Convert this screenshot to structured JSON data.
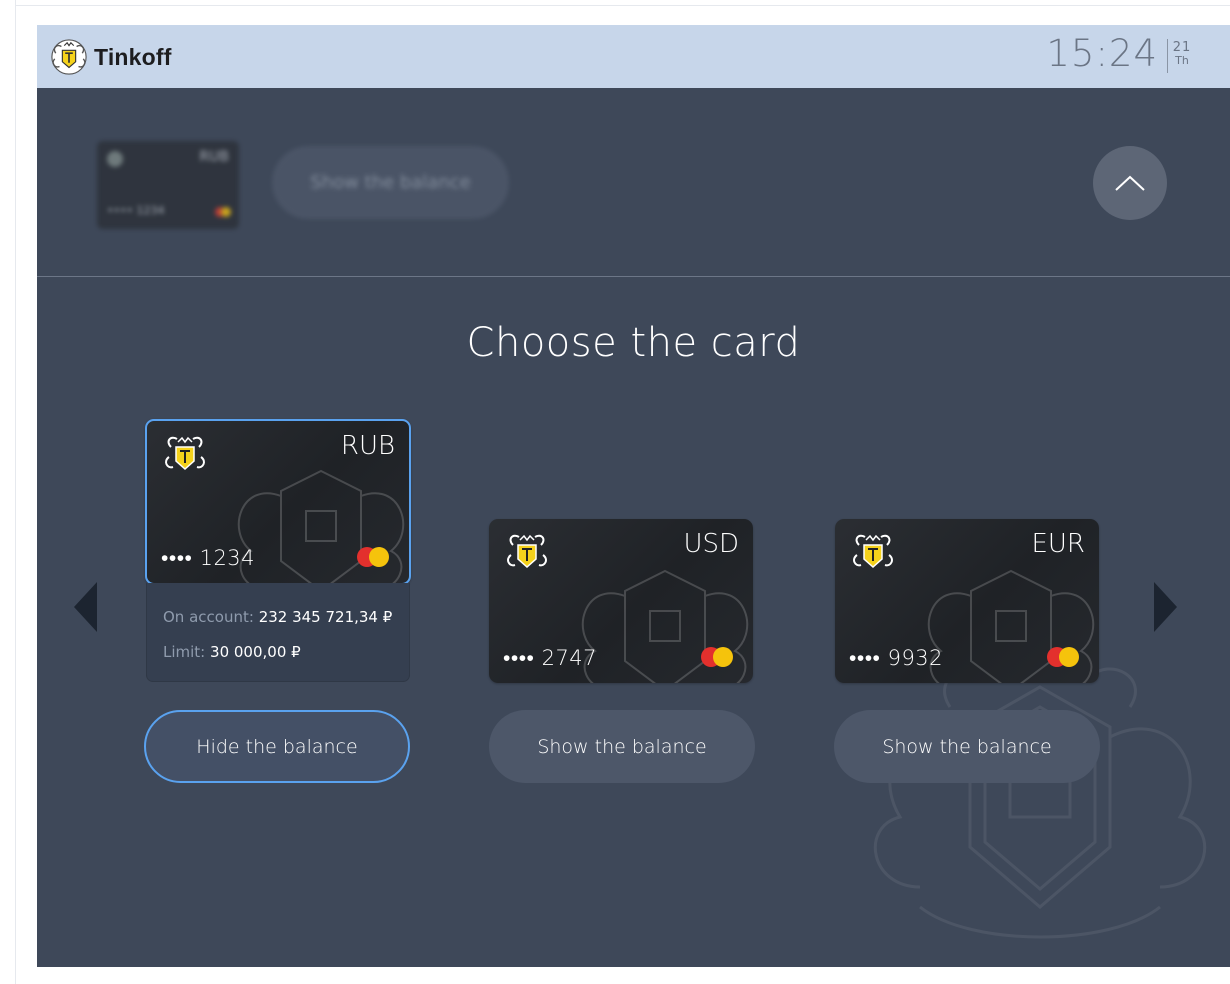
{
  "header": {
    "brand": "Tinkoff",
    "time": "15:24",
    "date_day": "21",
    "date_weekday": "Th"
  },
  "selected_strip": {
    "card_currency": "RUB",
    "card_number": "•••• 1234",
    "button_label": "Show the balance",
    "collapse_icon": "chevron-up-icon"
  },
  "title": "Choose the card",
  "cards": [
    {
      "currency": "RUB",
      "number": "•••• 1234",
      "selected": true,
      "balance": {
        "account_label": "On account:",
        "account_value": "232 345 721,34 ₽",
        "limit_label": "Limit:",
        "limit_value": "30 000,00 ₽"
      },
      "button_label": "Hide the balance"
    },
    {
      "currency": "USD",
      "number": "•••• 2747",
      "selected": false,
      "button_label": "Show the balance"
    },
    {
      "currency": "EUR",
      "number": "•••• 9932",
      "selected": false,
      "button_label": "Show the balance"
    }
  ],
  "navigation": {
    "prev_icon": "arrow-left-icon",
    "next_icon": "arrow-right-icon"
  },
  "colors": {
    "header_bg": "#c7d6ea",
    "screen_bg": "#3e4859",
    "accent": "#5aa2ef",
    "mastercard_red": "#e3302d",
    "mastercard_yellow": "#f5c30c",
    "brand_yellow": "#f5d21b"
  }
}
